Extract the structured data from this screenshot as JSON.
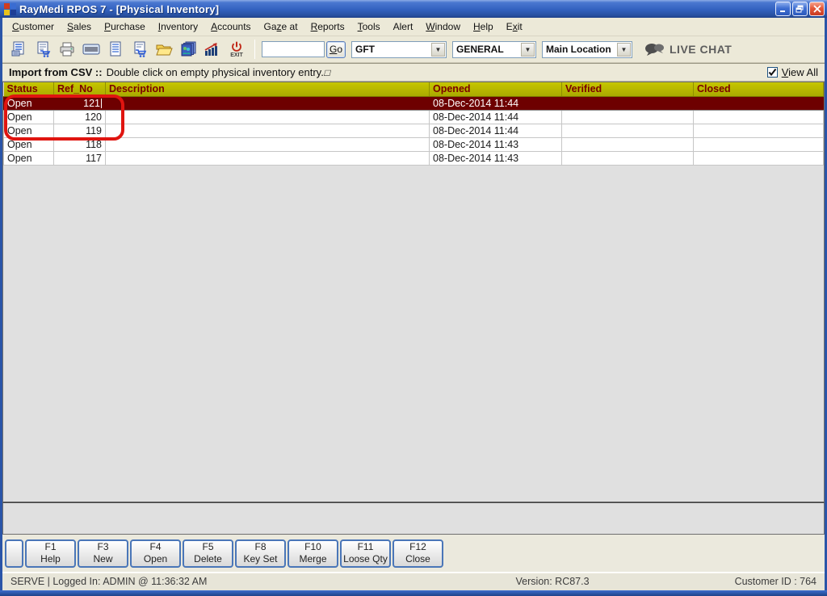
{
  "window": {
    "title": "RayMedi RPOS 7 - [Physical Inventory]"
  },
  "menu": {
    "items": [
      {
        "text": "Customer",
        "u": 0
      },
      {
        "text": "Sales",
        "u": 0
      },
      {
        "text": "Purchase",
        "u": 0
      },
      {
        "text": "Inventory",
        "u": 0
      },
      {
        "text": "Accounts",
        "u": 0
      },
      {
        "text": "Gaze at",
        "u": 2
      },
      {
        "text": "Reports",
        "u": 0
      },
      {
        "text": "Tools",
        "u": 0
      },
      {
        "text": "Alert",
        "u": -1
      },
      {
        "text": "Window",
        "u": 0
      },
      {
        "text": "Help",
        "u": 0
      },
      {
        "text": "Exit",
        "u": 1
      }
    ]
  },
  "toolbar": {
    "icon_names": [
      "billing-icon",
      "purchase-cart-icon",
      "printer-icon",
      "barcode-icon",
      "document-list-icon",
      "sales-cart-icon",
      "open-folder-icon",
      "gallery-icon",
      "chart-icon"
    ],
    "exit_label": "EXIT",
    "search_value": "",
    "go_button": {
      "text": "Go",
      "u": 0
    },
    "dropdowns": [
      {
        "value": "GFT"
      },
      {
        "value": "GENERAL"
      },
      {
        "value": "Main Location"
      }
    ],
    "live_chat_label": "LIVE CHAT"
  },
  "infobar": {
    "title": "Import from CSV ::",
    "message": "Double click on empty physical inventory entry.",
    "trailing_glyph": "□",
    "view_all": {
      "text": "View All",
      "u": 0,
      "checked": true
    }
  },
  "table": {
    "columns": [
      "Status",
      "Ref_No",
      "Description",
      "Opened",
      "Verified",
      "Closed"
    ],
    "selected_index": 0,
    "rows": [
      [
        "Open",
        "121",
        "",
        "08-Dec-2014 11:44",
        "",
        ""
      ],
      [
        "Open",
        "120",
        "",
        "08-Dec-2014 11:44",
        "",
        ""
      ],
      [
        "Open",
        "119",
        "",
        "08-Dec-2014 11:44",
        "",
        ""
      ],
      [
        "Open",
        "118",
        "",
        "08-Dec-2014 11:43",
        "",
        ""
      ],
      [
        "Open",
        "117",
        "",
        "08-Dec-2014 11:43",
        "",
        ""
      ]
    ]
  },
  "function_buttons": [
    {
      "key": "F1",
      "label": "Help"
    },
    {
      "key": "F3",
      "label": "New"
    },
    {
      "key": "F4",
      "label": "Open"
    },
    {
      "key": "F5",
      "label": "Delete"
    },
    {
      "key": "F8",
      "label": "Key Set"
    },
    {
      "key": "F10",
      "label": "Merge"
    },
    {
      "key": "F11",
      "label": "Loose Qty"
    },
    {
      "key": "F12",
      "label": "Close"
    }
  ],
  "statusbar": {
    "left": "SERVE |  Logged In: ADMIN  @ 11:36:32 AM",
    "center": "Version: RC87.3",
    "right": "Customer ID : 764"
  },
  "colors": {
    "titlebar_blue": "#2a55a8",
    "header_bg": "#b0b000",
    "header_text": "#7b0000",
    "selected_row_bg": "#6e0000",
    "annotation_red": "#e01510",
    "chrome_beige": "#ece9d8"
  }
}
